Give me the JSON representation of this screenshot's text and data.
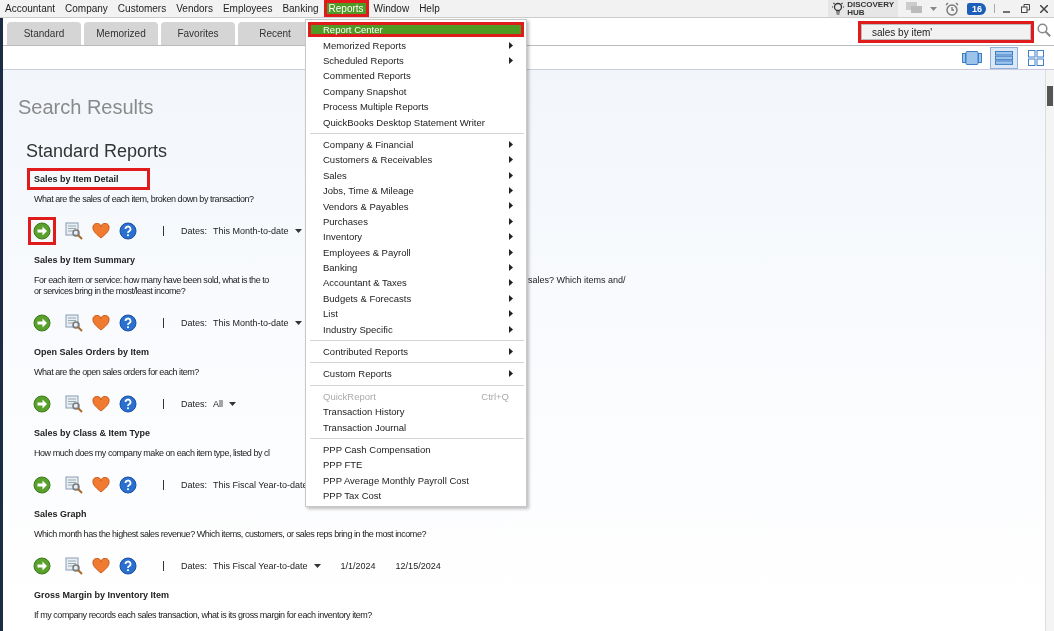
{
  "menubar": {
    "items": [
      {
        "label": "Accountant",
        "selected": false
      },
      {
        "label": "Company",
        "selected": false
      },
      {
        "label": "Customers",
        "selected": false
      },
      {
        "label": "Vendors",
        "selected": false
      },
      {
        "label": "Employees",
        "selected": false
      },
      {
        "label": "Banking",
        "selected": false
      },
      {
        "label": "Reports",
        "selected": true,
        "highlighted": true
      },
      {
        "label": "Window",
        "selected": false
      },
      {
        "label": "Help",
        "selected": false
      }
    ],
    "discovery_hub": [
      "DISCOVERY",
      "HUB"
    ],
    "reminder_count": "16"
  },
  "tabs": [
    {
      "label": "Standard",
      "selected": false
    },
    {
      "label": "Memorized",
      "selected": false
    },
    {
      "label": "Favorites",
      "selected": false
    },
    {
      "label": "Recent",
      "selected": false
    }
  ],
  "search": {
    "value": "sales by item'",
    "highlighted": true
  },
  "views": [
    {
      "kind": "carousel",
      "selected": false
    },
    {
      "kind": "list",
      "selected": true
    },
    {
      "kind": "grid",
      "selected": false
    }
  ],
  "page_title": "Search Results",
  "section_title": "Standard Reports",
  "reports": [
    {
      "title": "Sales by Item Detail",
      "title_highlighted": true,
      "description": [
        "What are the sales of each item, broken down by transaction?"
      ],
      "run_highlighted": true,
      "dates_label": "Dates:",
      "dates": "This Month-to-date",
      "dropdown": true
    },
    {
      "title": "Sales by Item Summary",
      "title_highlighted": false,
      "description": [
        "For each item or service: how many have been sold, what is the to",
        "or services bring in the most/least income?"
      ],
      "description_right": "sales? Which items and/",
      "run_highlighted": false,
      "dates_label": "Dates:",
      "dates": "This Month-to-date",
      "dropdown": true
    },
    {
      "title": "Open Sales Orders by Item",
      "title_highlighted": false,
      "description": [
        "What are the open sales orders for each item?"
      ],
      "run_highlighted": false,
      "dates_label": "Dates:",
      "dates": "All",
      "dropdown": true
    },
    {
      "title": "Sales by Class & Item Type",
      "title_highlighted": false,
      "description": [
        "How much does my company make on each item type, listed by cl"
      ],
      "run_highlighted": false,
      "dates_label": "Dates:",
      "dates": "This Fiscal Year-to-date",
      "dropdown": false
    },
    {
      "title": "Sales Graph",
      "title_highlighted": false,
      "description": [
        "Which month has the highest sales revenue? Which items, customers, or sales reps bring in the most income?"
      ],
      "run_highlighted": false,
      "dates_label": "Dates:",
      "dates": "This Fiscal Year-to-date",
      "dropdown": true,
      "from": "1/1/2024",
      "to": "12/15/2024"
    },
    {
      "title": "Gross Margin by Inventory Item",
      "title_highlighted": false,
      "description": [
        "If my company records each sales transaction, what is its gross margin for each inventory item?"
      ]
    }
  ],
  "reports_menu": {
    "sections": [
      [
        {
          "label": "Report Center",
          "selected": true,
          "highlighted": true,
          "submenu": false,
          "disabled": false
        },
        {
          "label": "Memorized Reports",
          "selected": false,
          "submenu": true,
          "disabled": false
        },
        {
          "label": "Scheduled Reports",
          "selected": false,
          "submenu": true,
          "disabled": false
        },
        {
          "label": "Commented Reports",
          "selected": false,
          "submenu": false,
          "disabled": false
        },
        {
          "label": "Company Snapshot",
          "selected": false,
          "submenu": false,
          "disabled": false
        },
        {
          "label": "Process Multiple Reports",
          "selected": false,
          "submenu": false,
          "disabled": false
        },
        {
          "label": "QuickBooks Desktop Statement Writer",
          "selected": false,
          "submenu": false,
          "disabled": false
        }
      ],
      [
        {
          "label": "Company & Financial",
          "selected": false,
          "submenu": true,
          "disabled": false
        },
        {
          "label": "Customers & Receivables",
          "selected": false,
          "submenu": true,
          "disabled": false
        },
        {
          "label": "Sales",
          "selected": false,
          "submenu": true,
          "disabled": false
        },
        {
          "label": "Jobs, Time & Mileage",
          "selected": false,
          "submenu": true,
          "disabled": false
        },
        {
          "label": "Vendors & Payables",
          "selected": false,
          "submenu": true,
          "disabled": false
        },
        {
          "label": "Purchases",
          "selected": false,
          "submenu": true,
          "disabled": false
        },
        {
          "label": "Inventory",
          "selected": false,
          "submenu": true,
          "disabled": false
        },
        {
          "label": "Employees & Payroll",
          "selected": false,
          "submenu": true,
          "disabled": false
        },
        {
          "label": "Banking",
          "selected": false,
          "submenu": true,
          "disabled": false
        },
        {
          "label": "Accountant & Taxes",
          "selected": false,
          "submenu": true,
          "disabled": false
        },
        {
          "label": "Budgets & Forecasts",
          "selected": false,
          "submenu": true,
          "disabled": false
        },
        {
          "label": "List",
          "selected": false,
          "submenu": true,
          "disabled": false
        },
        {
          "label": "Industry Specific",
          "selected": false,
          "submenu": true,
          "disabled": false
        }
      ],
      [
        {
          "label": "Contributed Reports",
          "selected": false,
          "submenu": true,
          "disabled": false
        }
      ],
      [
        {
          "label": "Custom Reports",
          "selected": false,
          "submenu": true,
          "disabled": false
        }
      ],
      [
        {
          "label": "QuickReport",
          "selected": false,
          "submenu": false,
          "disabled": true,
          "shortcut": "Ctrl+Q"
        },
        {
          "label": "Transaction History",
          "selected": false,
          "submenu": false,
          "disabled": false
        },
        {
          "label": "Transaction Journal",
          "selected": false,
          "submenu": false,
          "disabled": false
        }
      ],
      [
        {
          "label": "PPP Cash Compensation",
          "selected": false,
          "submenu": false,
          "disabled": false
        },
        {
          "label": "PPP FTE",
          "selected": false,
          "submenu": false,
          "disabled": false
        },
        {
          "label": "PPP Average Monthly Payroll Cost",
          "selected": false,
          "submenu": false,
          "disabled": false
        },
        {
          "label": "PPP Tax Cost",
          "selected": false,
          "submenu": false,
          "disabled": false
        }
      ]
    ]
  }
}
